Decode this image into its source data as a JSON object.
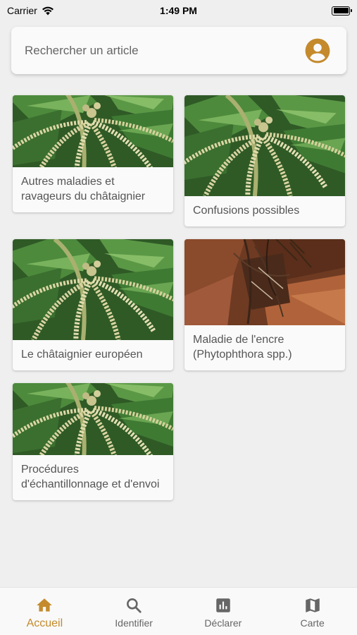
{
  "status_bar": {
    "carrier": "Carrier",
    "time": "1:49 PM"
  },
  "search": {
    "placeholder": "Rechercher un article",
    "account_icon": "account-circle-icon"
  },
  "colors": {
    "accent": "#c48a2c",
    "background": "#efefef"
  },
  "articles": [
    {
      "title": "Autres maladies et ravageurs du châtaignier",
      "image": "chestnut-flowers"
    },
    {
      "title": "Confusions possibles",
      "image": "chestnut-flowers"
    },
    {
      "title": "Le châtaignier européen",
      "image": "chestnut-flowers"
    },
    {
      "title": "Maladie de l'encre (Phytophthora spp.)",
      "image": "root-collar-bark"
    },
    {
      "title": "Procédures d'échantillonnage et d'envoi",
      "image": "chestnut-flowers"
    }
  ],
  "nav": {
    "items": [
      {
        "label": "Accueil",
        "icon": "home-icon",
        "active": true
      },
      {
        "label": "Identifier",
        "icon": "search-icon",
        "active": false
      },
      {
        "label": "Déclarer",
        "icon": "chart-icon",
        "active": false
      },
      {
        "label": "Carte",
        "icon": "map-icon",
        "active": false
      }
    ]
  }
}
